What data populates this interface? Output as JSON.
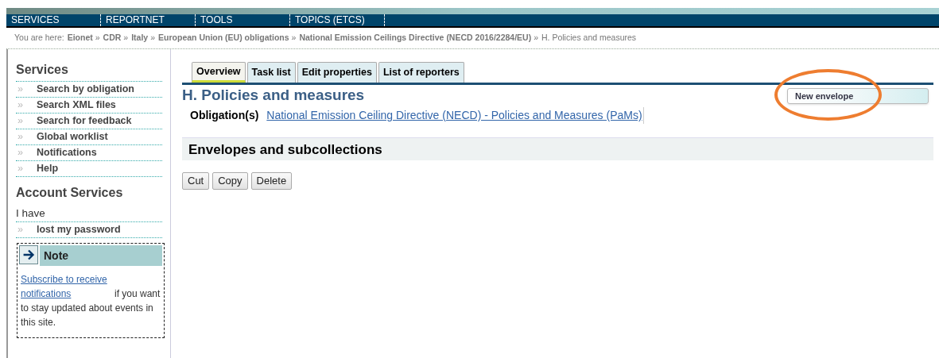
{
  "nav": [
    {
      "label": "SERVICES"
    },
    {
      "label": "REPORTNET"
    },
    {
      "label": "TOOLS"
    },
    {
      "label": "TOPICS (ETCS)"
    }
  ],
  "breadcrumb": {
    "prefix": "You are here:",
    "items": [
      "Eionet",
      "CDR",
      "Italy",
      "European Union (EU) obligations",
      "National Emission Ceilings Directive (NECD 2016/2284/EU)"
    ],
    "separator": "»",
    "current": "H. Policies and measures"
  },
  "sidebar": {
    "title": "Services",
    "bullet": "»",
    "items": [
      "Search by obligation",
      "Search XML files",
      "Search for feedback",
      "Global worklist",
      "Notifications",
      "Help"
    ],
    "account_title": "Account Services",
    "account_text": "I have",
    "account_items": [
      "lost my password"
    ],
    "note": {
      "title": "Note",
      "link": "Subscribe to receive notifications ",
      "text": "if you want to stay updated about events in this site."
    }
  },
  "tabs": [
    {
      "label": "Overview",
      "selected": true
    },
    {
      "label": "Task list",
      "selected": false
    },
    {
      "label": "Edit properties",
      "selected": false
    },
    {
      "label": "List of reporters",
      "selected": false
    }
  ],
  "title": "H. Policies and measures",
  "new_envelope": {
    "label": "New envelope",
    "highlighted": true
  },
  "obligation": {
    "label": "Obligation(s)",
    "link": "National Emission Ceiling Directive (NECD) - Policies and Measures (PaMs)"
  },
  "section_title": "Envelopes and subcollections",
  "buttons": [
    "Cut",
    "Copy",
    "Delete"
  ]
}
